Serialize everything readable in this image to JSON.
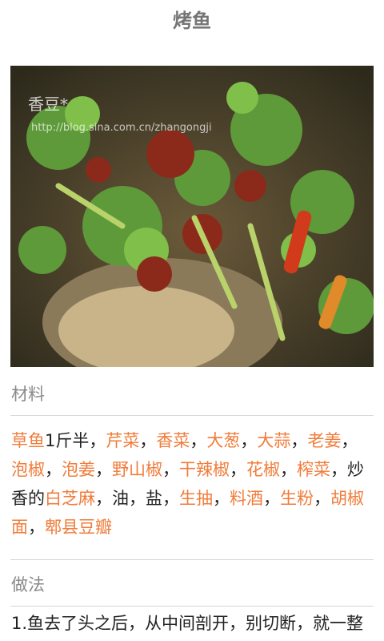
{
  "header": {
    "title": "烤鱼"
  },
  "photo": {
    "watermark_text": "香豆*",
    "watermark_url": "http://blog.sina.com.cn/zhangongji"
  },
  "materials": {
    "label": "材料",
    "items": [
      {
        "text": "草鱼",
        "link": true
      },
      {
        "text": "1斤半，",
        "link": false
      },
      {
        "text": "芹菜",
        "link": true
      },
      {
        "text": "，",
        "link": false
      },
      {
        "text": "香菜",
        "link": true
      },
      {
        "text": "，",
        "link": false
      },
      {
        "text": "大葱",
        "link": true
      },
      {
        "text": "，",
        "link": false
      },
      {
        "text": "大蒜",
        "link": true
      },
      {
        "text": "，",
        "link": false
      },
      {
        "text": "老姜",
        "link": true
      },
      {
        "text": "，",
        "link": false
      },
      {
        "text": "泡椒",
        "link": true
      },
      {
        "text": "，",
        "link": false
      },
      {
        "text": "泡姜",
        "link": true
      },
      {
        "text": "，",
        "link": false
      },
      {
        "text": "野山椒",
        "link": true
      },
      {
        "text": "，",
        "link": false
      },
      {
        "text": "干辣椒",
        "link": true
      },
      {
        "text": "，",
        "link": false
      },
      {
        "text": "花椒",
        "link": true
      },
      {
        "text": "，",
        "link": false
      },
      {
        "text": "榨菜",
        "link": true
      },
      {
        "text": "，炒香的",
        "link": false
      },
      {
        "text": "白芝麻",
        "link": true
      },
      {
        "text": "，油，盐，",
        "link": false
      },
      {
        "text": "生抽",
        "link": true
      },
      {
        "text": "，",
        "link": false
      },
      {
        "text": "料酒",
        "link": true
      },
      {
        "text": "，",
        "link": false
      },
      {
        "text": "生粉",
        "link": true
      },
      {
        "text": "，",
        "link": false
      },
      {
        "text": "胡椒面",
        "link": true
      },
      {
        "text": "，",
        "link": false
      },
      {
        "text": "郫县豆瓣",
        "link": true
      }
    ]
  },
  "method": {
    "label": "做法",
    "step1": "1.鱼去了头之后，从中间剖开，别切断，就一整"
  },
  "colors": {
    "link": "#f07c3a",
    "divider": "#d6d6d6",
    "title": "#757575"
  }
}
